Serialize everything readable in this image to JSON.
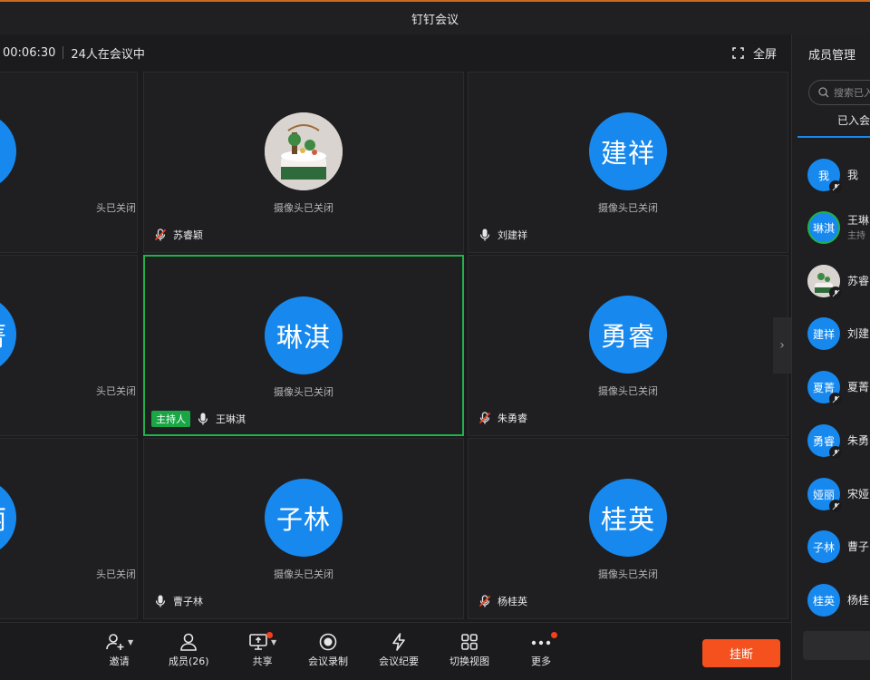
{
  "window": {
    "title": "钉钉会议"
  },
  "topbar": {
    "timer": "00:06:30",
    "participants": "24人在会议中",
    "fullscreen_label": "全屏"
  },
  "tiles": [
    {
      "avatar_text": "",
      "cam": "头已关闭",
      "name": "",
      "mic": "none"
    },
    {
      "avatar_text": "",
      "cam": "摄像头已关闭",
      "name": "苏睿颖",
      "mic": "muted",
      "image": true
    },
    {
      "avatar_text": "建祥",
      "cam": "摄像头已关闭",
      "name": "刘建祥",
      "mic": "on"
    },
    {
      "avatar_text": "菁",
      "cam": "头已关闭",
      "name": "",
      "mic": "none"
    },
    {
      "avatar_text": "琳淇",
      "cam": "摄像头已关闭",
      "name": "王琳淇",
      "mic": "on",
      "host_tag": "主持人"
    },
    {
      "avatar_text": "勇睿",
      "cam": "摄像头已关闭",
      "name": "朱勇睿",
      "mic": "muted"
    },
    {
      "avatar_text": "丽",
      "cam": "头已关闭",
      "name": "",
      "mic": "none"
    },
    {
      "avatar_text": "子林",
      "cam": "摄像头已关闭",
      "name": "曹子林",
      "mic": "on"
    },
    {
      "avatar_text": "桂英",
      "cam": "摄像头已关闭",
      "name": "杨桂英",
      "mic": "muted"
    }
  ],
  "sidebar": {
    "title": "成员管理",
    "search_placeholder": "搜索已入",
    "tab_joined": "已入会",
    "members": [
      {
        "avatar": "我",
        "name": "我",
        "role": ""
      },
      {
        "avatar": "琳淇",
        "name": "王琳",
        "role": "主持"
      },
      {
        "avatar": "",
        "name": "苏睿",
        "role": ""
      },
      {
        "avatar": "建祥",
        "name": "刘建",
        "role": ""
      },
      {
        "avatar": "夏菁",
        "name": "夏菁",
        "role": ""
      },
      {
        "avatar": "勇睿",
        "name": "朱勇",
        "role": ""
      },
      {
        "avatar": "娅丽",
        "name": "宋娅",
        "role": ""
      },
      {
        "avatar": "子林",
        "name": "曹子",
        "role": ""
      },
      {
        "avatar": "桂英",
        "name": "杨桂",
        "role": ""
      }
    ]
  },
  "toolbar": {
    "invite": "邀请",
    "members": "成员(26)",
    "share": "共享",
    "record": "会议录制",
    "minutes": "会议纪要",
    "switch_view": "切换视图",
    "more": "更多",
    "hangup": "挂断"
  },
  "colors": {
    "accent": "#1789ee",
    "host_green": "#21b04b",
    "hangup": "#f5511e",
    "notify_dot": "#f5401f"
  }
}
